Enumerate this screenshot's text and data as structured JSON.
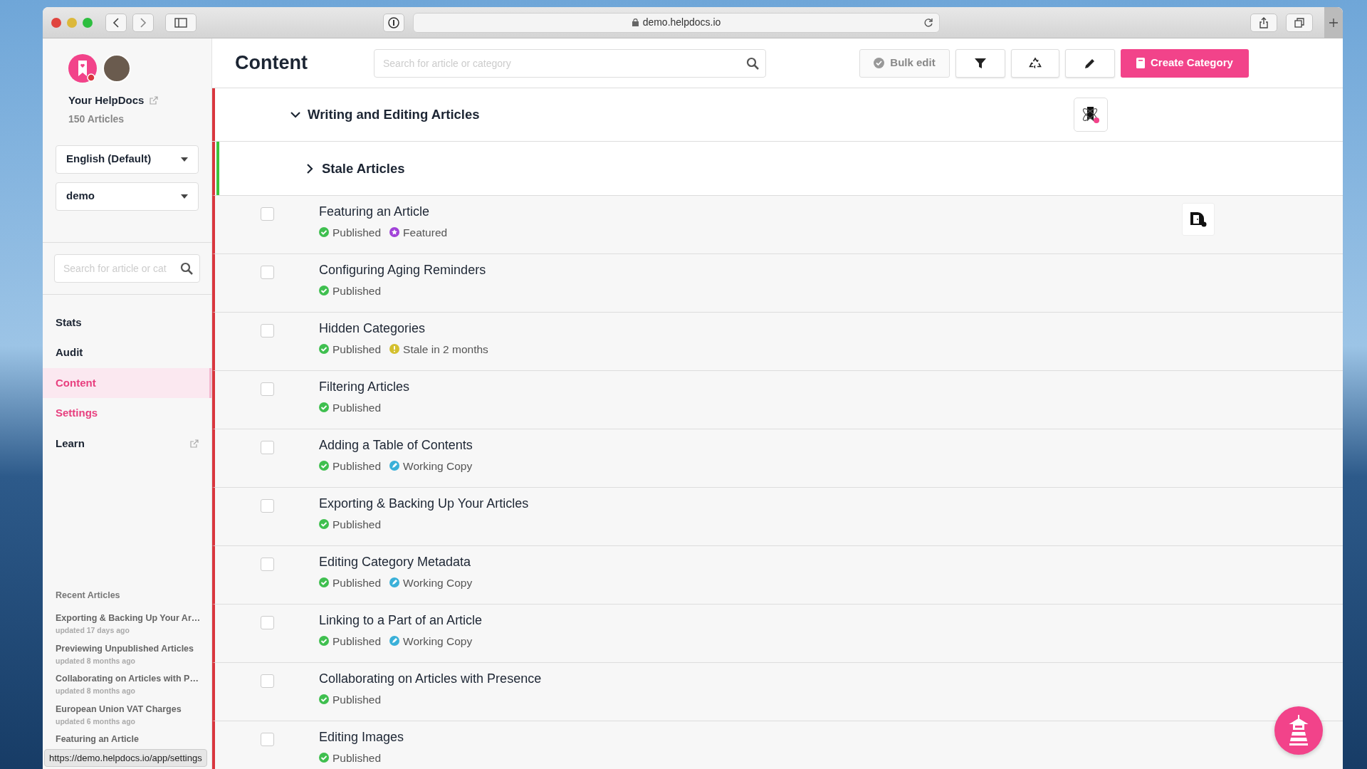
{
  "browser": {
    "url": "demo.helpdocs.io",
    "status_url": "https://demo.helpdocs.io/app/settings"
  },
  "sidebar": {
    "brand_name": "Your HelpDocs",
    "article_count": "150 Articles",
    "language_select": "English (Default)",
    "project_select": "demo",
    "search": {
      "placeholder": "Search for article or cat"
    },
    "nav": [
      {
        "label": "Stats",
        "selected": false,
        "hovered": false,
        "external": false
      },
      {
        "label": "Audit",
        "selected": false,
        "hovered": false,
        "external": false
      },
      {
        "label": "Content",
        "selected": true,
        "hovered": false,
        "external": false
      },
      {
        "label": "Settings",
        "selected": false,
        "hovered": true,
        "external": false
      },
      {
        "label": "Learn",
        "selected": false,
        "hovered": false,
        "external": true
      }
    ],
    "recent_title": "Recent Articles",
    "recent": [
      {
        "title": "Exporting & Backing Up Your Ar…",
        "updated": "updated 17 days ago"
      },
      {
        "title": "Previewing Unpublished Articles",
        "updated": "updated 8 months ago"
      },
      {
        "title": "Collaborating on Articles with P…",
        "updated": "updated 8 months ago"
      },
      {
        "title": "European Union VAT Charges",
        "updated": "updated 6 months ago"
      },
      {
        "title": "Featuring an Article"
      }
    ]
  },
  "header": {
    "title": "Content",
    "search": {
      "placeholder": "Search for article or category"
    },
    "bulk_edit": {
      "label": "Bulk edit",
      "disabled": true
    },
    "create_button": "Create Category"
  },
  "category": {
    "title": "Writing and Editing Articles",
    "expanded": true,
    "color": "#d9363e"
  },
  "subcategory": {
    "title": "Stale Articles",
    "expanded": false,
    "color": "#3ec43e"
  },
  "articles": [
    {
      "title": "Featuring an Article",
      "checked": false,
      "statuses": [
        {
          "kind": "published",
          "label": "Published"
        },
        {
          "kind": "featured",
          "label": "Featured"
        }
      ]
    },
    {
      "title": "Configuring Aging Reminders",
      "checked": false,
      "statuses": [
        {
          "kind": "published",
          "label": "Published"
        }
      ]
    },
    {
      "title": "Hidden Categories",
      "checked": false,
      "statuses": [
        {
          "kind": "published",
          "label": "Published"
        },
        {
          "kind": "stale",
          "label": "Stale in 2 months"
        }
      ]
    },
    {
      "title": "Filtering Articles",
      "checked": false,
      "statuses": [
        {
          "kind": "published",
          "label": "Published"
        }
      ]
    },
    {
      "title": "Adding a Table of Contents",
      "checked": false,
      "statuses": [
        {
          "kind": "published",
          "label": "Published"
        },
        {
          "kind": "working_copy",
          "label": "Working Copy"
        }
      ]
    },
    {
      "title": "Exporting & Backing Up Your Articles",
      "checked": false,
      "statuses": [
        {
          "kind": "published",
          "label": "Published"
        }
      ]
    },
    {
      "title": "Editing Category Metadata",
      "checked": false,
      "statuses": [
        {
          "kind": "published",
          "label": "Published"
        },
        {
          "kind": "working_copy",
          "label": "Working Copy"
        }
      ]
    },
    {
      "title": "Linking to a Part of an Article",
      "checked": false,
      "statuses": [
        {
          "kind": "published",
          "label": "Published"
        },
        {
          "kind": "working_copy",
          "label": "Working Copy"
        }
      ]
    },
    {
      "title": "Collaborating on Articles with Presence",
      "checked": false,
      "statuses": [
        {
          "kind": "published",
          "label": "Published"
        }
      ]
    },
    {
      "title": "Editing Images",
      "checked": false,
      "statuses": [
        {
          "kind": "published",
          "label": "Published"
        }
      ]
    }
  ]
}
